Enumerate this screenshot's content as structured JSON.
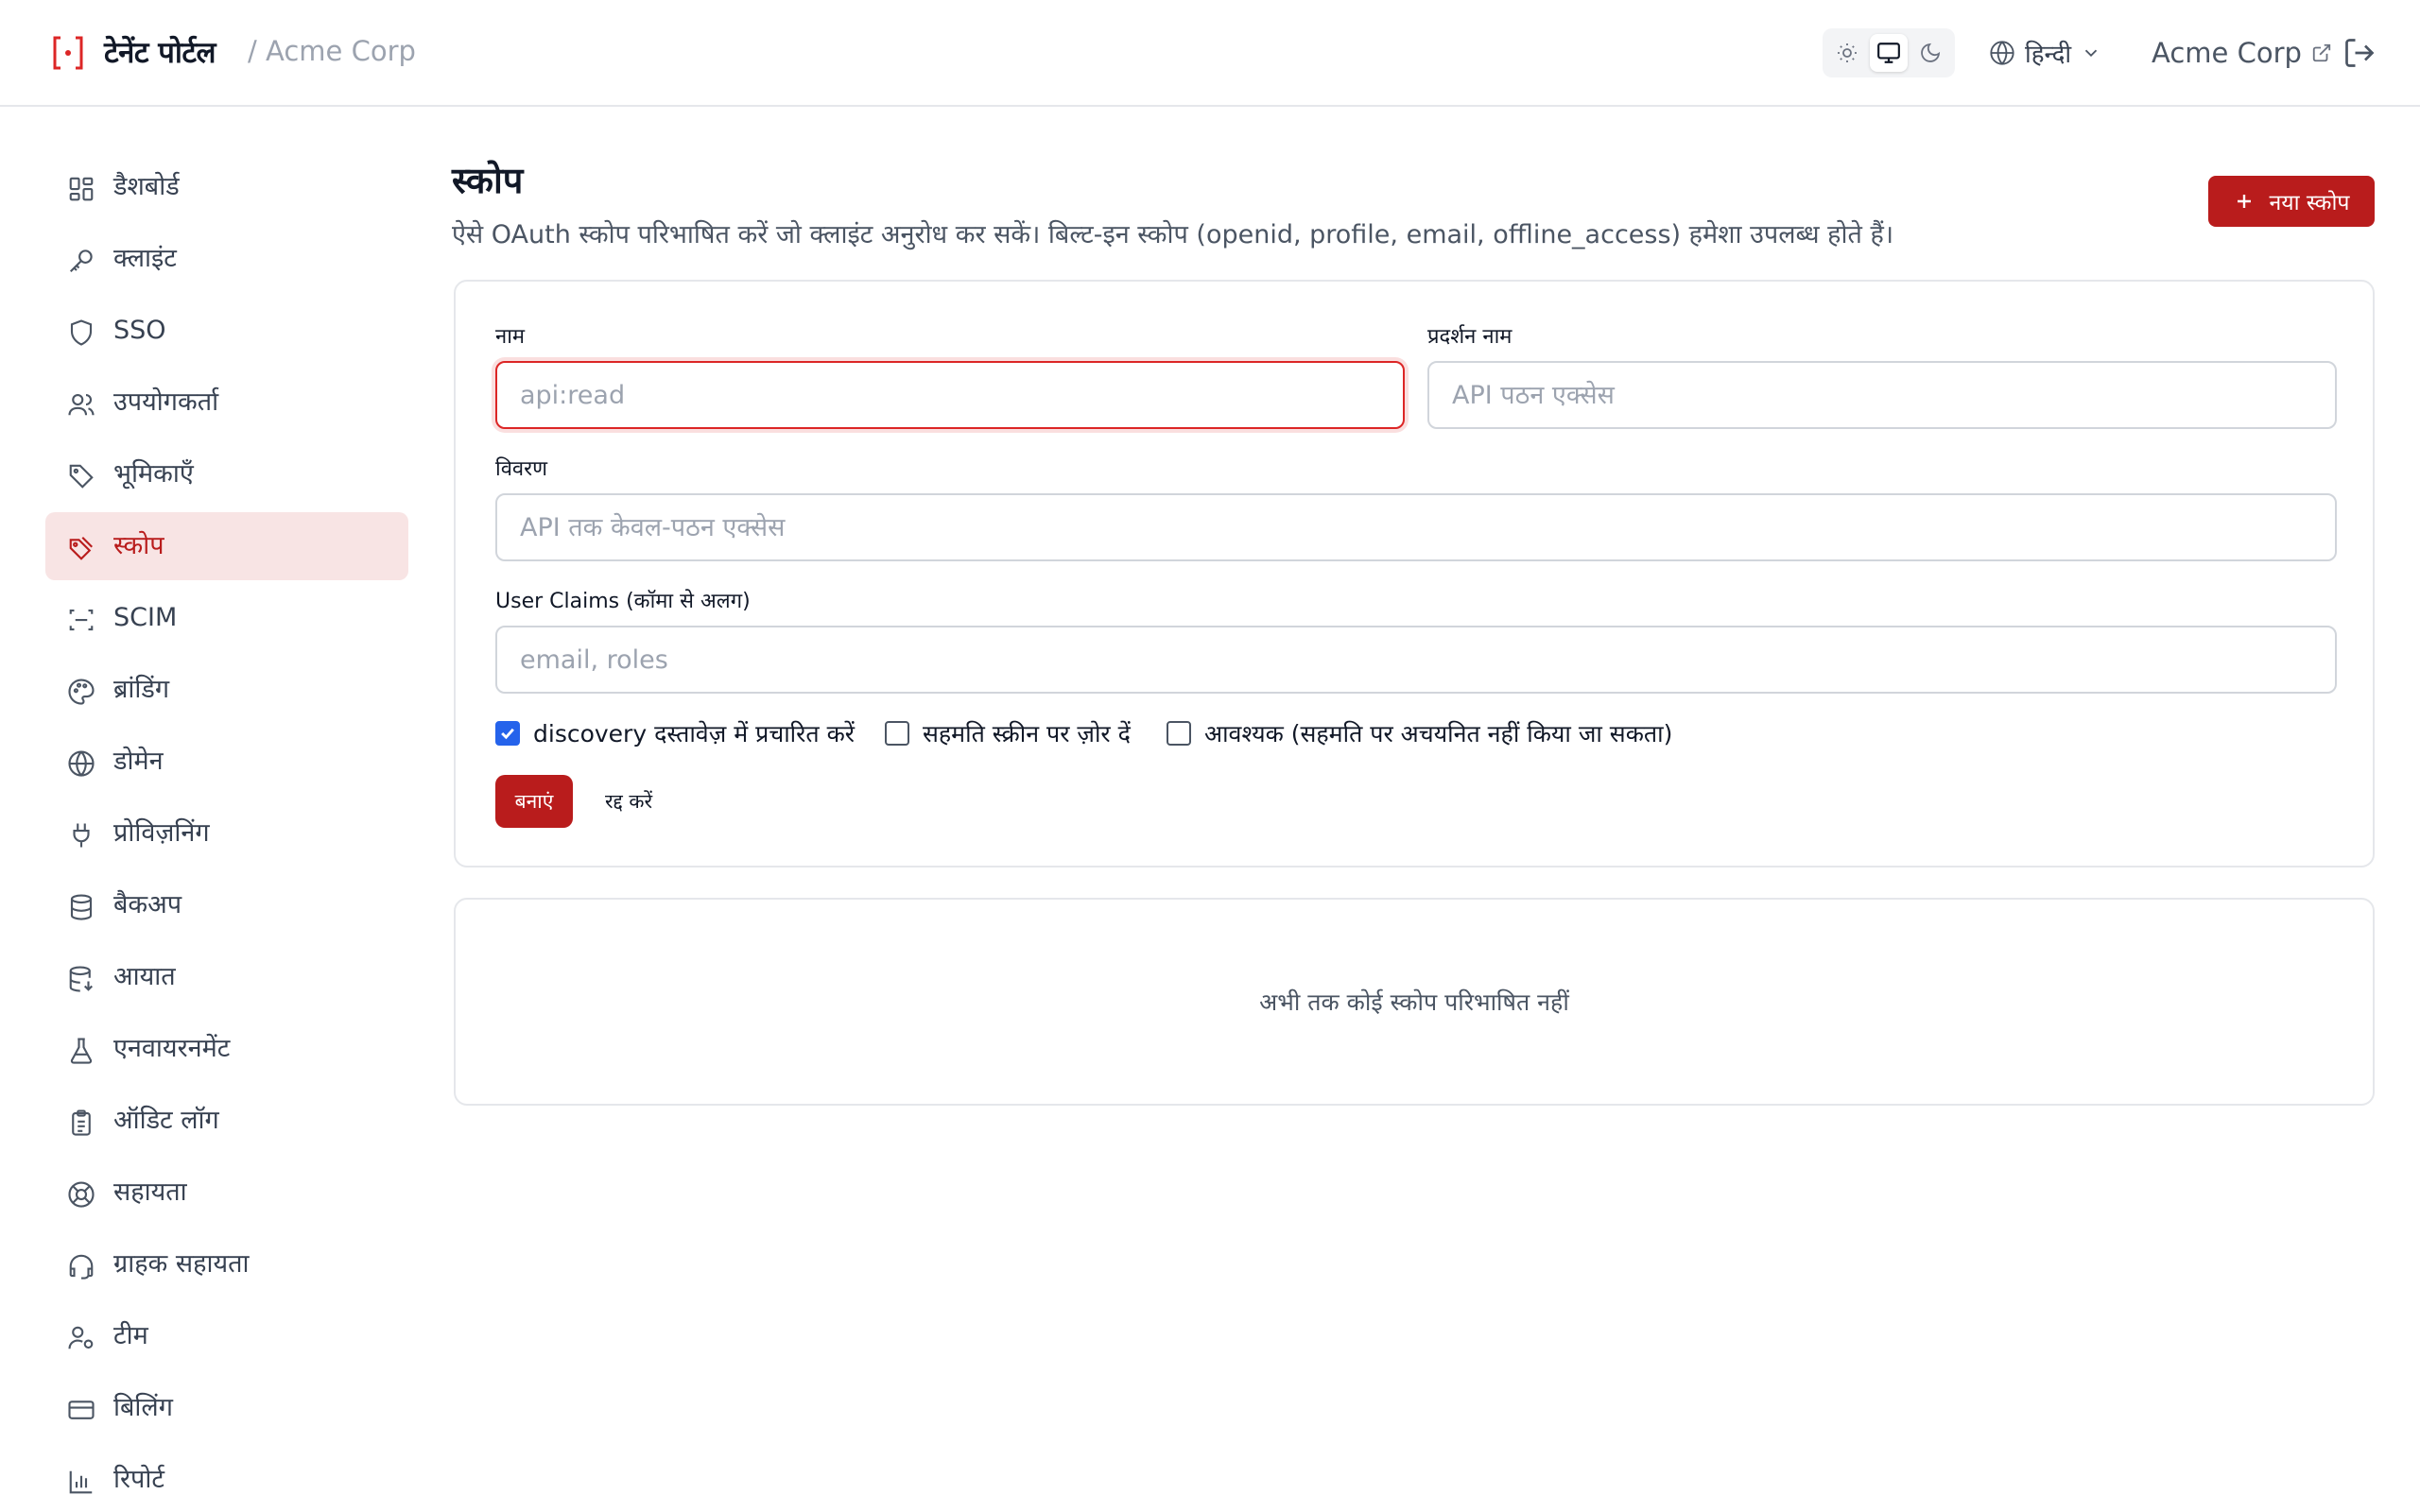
{
  "header": {
    "brand": "टेनेंट पोर्टल",
    "org_breadcrumb": "/ Acme Corp",
    "theme_options": [
      "light",
      "system",
      "dark"
    ],
    "theme_selected": "system",
    "language": "हिन्दी",
    "tenant_link": "Acme Corp"
  },
  "sidebar": {
    "items": [
      {
        "label": "डैशबोर्ड",
        "icon": "dashboard-grid-icon"
      },
      {
        "label": "क्लाइंट",
        "icon": "key-icon"
      },
      {
        "label": "SSO",
        "icon": "shield-icon"
      },
      {
        "label": "उपयोगकर्ता",
        "icon": "users-icon"
      },
      {
        "label": "भूमिकाएँ",
        "icon": "tag-icon"
      },
      {
        "label": "स्कोप",
        "icon": "tags-icon",
        "active": true
      },
      {
        "label": "SCIM",
        "icon": "scan-icon"
      },
      {
        "label": "ब्रांडिंग",
        "icon": "palette-icon"
      },
      {
        "label": "डोमेन",
        "icon": "globe-icon"
      },
      {
        "label": "प्रोविज़निंग",
        "icon": "plug-icon"
      },
      {
        "label": "बैकअप",
        "icon": "database-icon"
      },
      {
        "label": "आयात",
        "icon": "database-import-icon"
      },
      {
        "label": "एनवायरनमेंट",
        "icon": "flask-icon"
      },
      {
        "label": "ऑडिट लॉग",
        "icon": "clipboard-icon"
      },
      {
        "label": "सहायता",
        "icon": "lifebuoy-icon"
      },
      {
        "label": "ग्राहक सहायता",
        "icon": "headset-icon"
      },
      {
        "label": "टीम",
        "icon": "user-cog-icon"
      },
      {
        "label": "बिलिंग",
        "icon": "credit-card-icon"
      },
      {
        "label": "रिपोर्ट",
        "icon": "bar-chart-icon"
      }
    ]
  },
  "page": {
    "title": "स्कोप",
    "description": "ऐसे OAuth स्कोप परिभाषित करें जो क्लाइंट अनुरोध कर सकें। बिल्ट-इन स्कोप (openid, profile, email, offline_access) हमेशा उपलब्ध होते हैं।",
    "new_button": "नया स्कोप"
  },
  "form": {
    "name_label": "नाम",
    "name_placeholder": "api:read",
    "name_value": "",
    "display_name_label": "प्रदर्शन नाम",
    "display_name_placeholder": "API पठन एक्सेस",
    "display_name_value": "",
    "description_label": "विवरण",
    "description_placeholder": "API तक केवल-पठन एक्सेस",
    "description_value": "",
    "claims_label": "User Claims (कॉमा से अलग)",
    "claims_placeholder": "email, roles",
    "claims_value": "",
    "checkboxes": [
      {
        "label": "discovery दस्तावेज़ में प्रचारित करें",
        "checked": true
      },
      {
        "label": "सहमति स्क्रीन पर ज़ोर दें",
        "checked": false
      },
      {
        "label": "आवश्यक (सहमति पर अचयनित नहीं किया जा सकता)",
        "checked": false
      }
    ],
    "create_button": "बनाएं",
    "cancel_button": "रद्द करें"
  },
  "empty_state": {
    "message": "अभी तक कोई स्कोप परिभाषित नहीं"
  },
  "colors": {
    "accent": "#b91c1c",
    "active_nav_bg": "#f8e4e4",
    "checkbox_checked": "#2563eb"
  }
}
